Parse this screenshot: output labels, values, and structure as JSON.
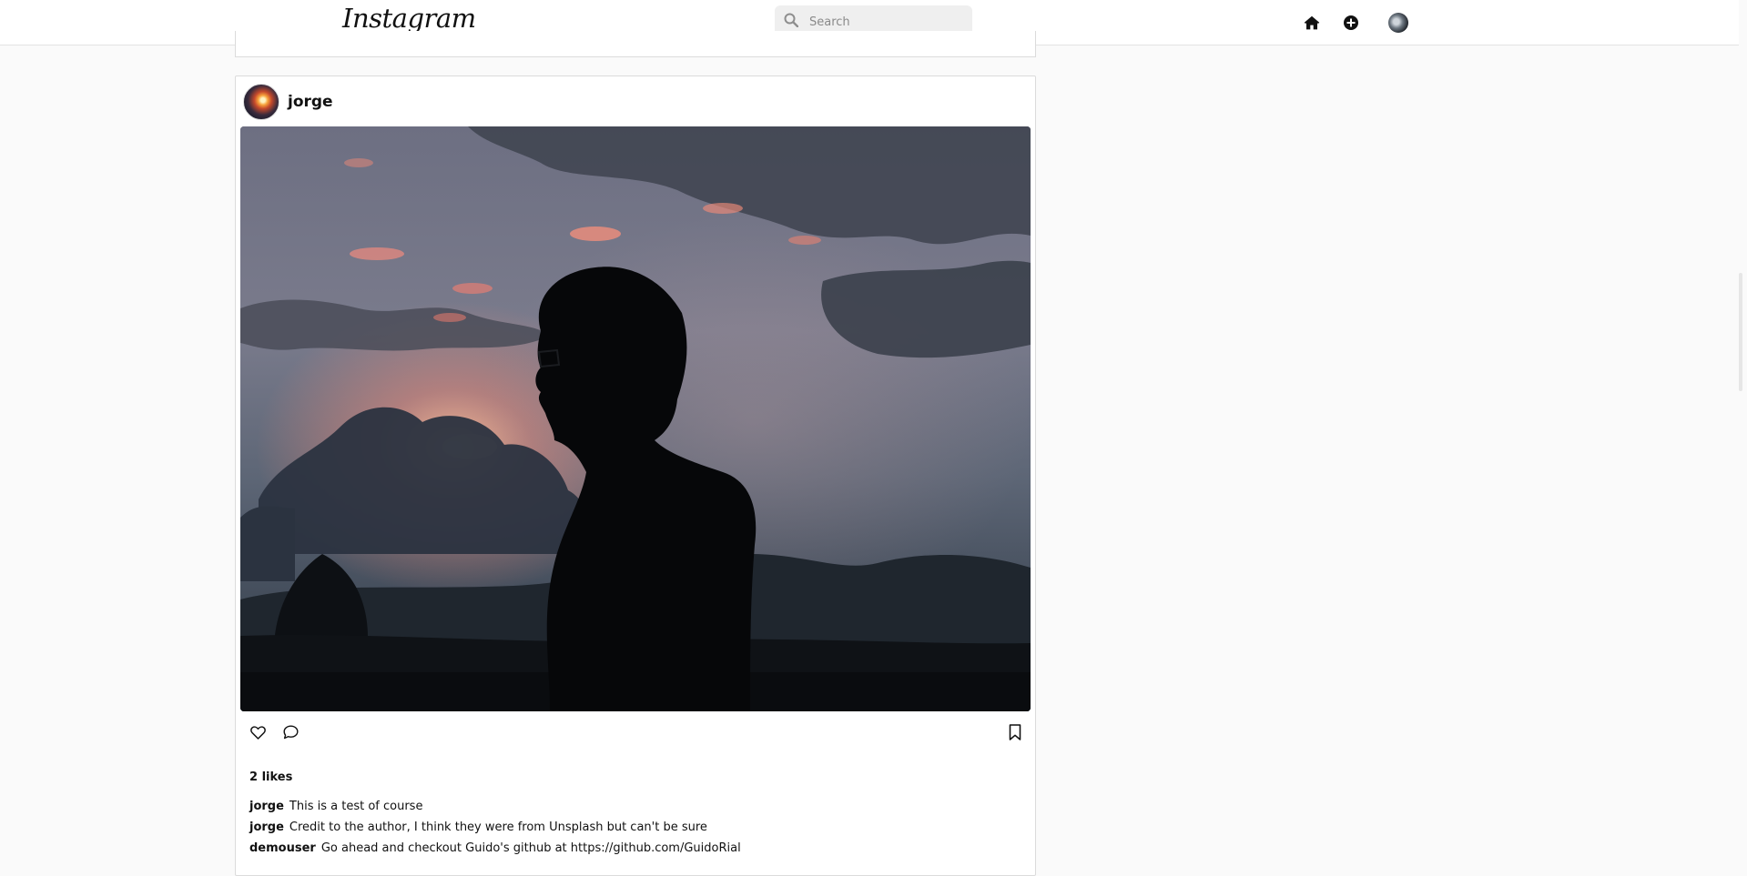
{
  "header": {
    "logo": "Instagram",
    "search_placeholder": "Search"
  },
  "post": {
    "username": "jorge",
    "likes": "2 likes",
    "comments": [
      {
        "user": "jorge",
        "text": "This is a test of course"
      },
      {
        "user": "jorge",
        "text": "Credit to the author, I think they were from Unsplash but can't be sure"
      },
      {
        "user": "demouser",
        "text": "Go ahead and checkout Guido's github at https://github.com/GuidoRial"
      }
    ]
  },
  "icons": {
    "search": "search-icon",
    "home": "home-icon",
    "add": "add-post-icon",
    "like": "heart-icon",
    "comment": "comment-icon",
    "save": "bookmark-icon"
  }
}
